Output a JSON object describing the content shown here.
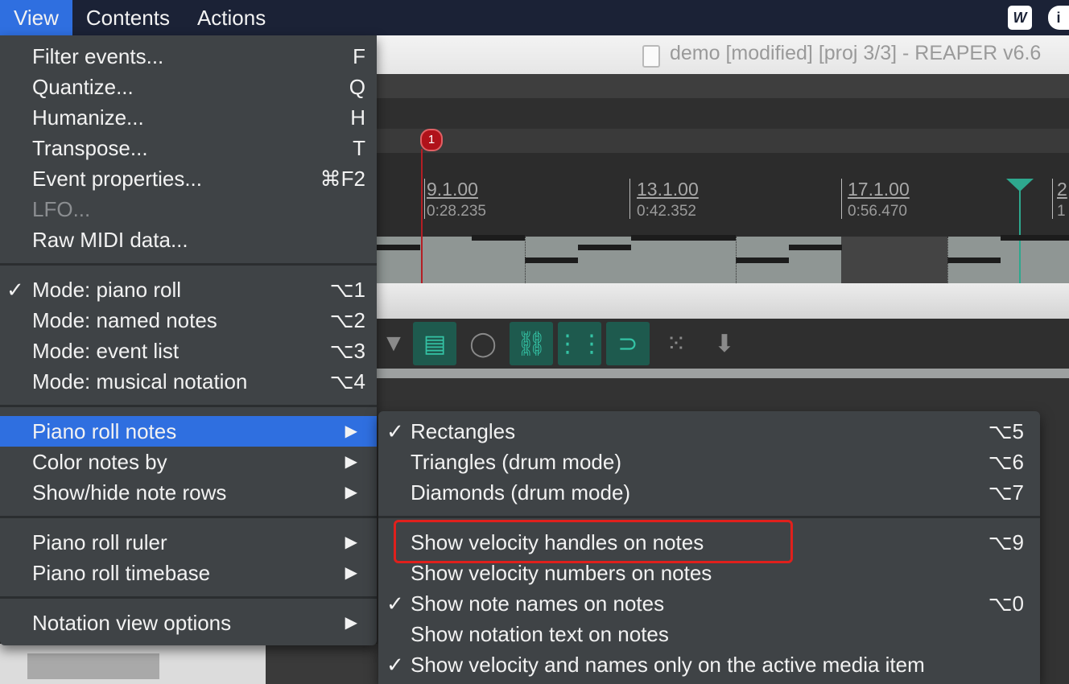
{
  "menubar": {
    "items": [
      "View",
      "Contents",
      "Actions"
    ],
    "active": "View"
  },
  "window": {
    "title": "demo [modified] [proj 3/3] - REAPER v6.6"
  },
  "ruler": {
    "marker": "1",
    "labels": [
      {
        "measure": "9.1.00",
        "time": "0:28.235"
      },
      {
        "measure": "13.1.00",
        "time": "0:42.352"
      },
      {
        "measure": "17.1.00",
        "time": "0:56.470"
      },
      {
        "measure": "2",
        "time": "1"
      }
    ]
  },
  "view_menu": {
    "items": [
      {
        "label": "Filter events...",
        "shortcut": "F"
      },
      {
        "label": "Quantize...",
        "shortcut": "Q"
      },
      {
        "label": "Humanize...",
        "shortcut": "H"
      },
      {
        "label": "Transpose...",
        "shortcut": "T"
      },
      {
        "label": "Event properties...",
        "shortcut": "⌘F2"
      },
      {
        "label": "LFO...",
        "shortcut": "",
        "disabled": true
      },
      {
        "label": "Raw MIDI data...",
        "shortcut": ""
      },
      {
        "label": "Mode: piano roll",
        "shortcut": "⌥1",
        "checked": true
      },
      {
        "label": "Mode: named notes",
        "shortcut": "⌥2"
      },
      {
        "label": "Mode: event list",
        "shortcut": "⌥3"
      },
      {
        "label": "Mode: musical notation",
        "shortcut": "⌥4"
      },
      {
        "label": "Piano roll notes",
        "submenu": true,
        "highlighted": true
      },
      {
        "label": "Color notes by",
        "submenu": true
      },
      {
        "label": "Show/hide note rows",
        "submenu": true
      },
      {
        "label": "Piano roll ruler",
        "submenu": true
      },
      {
        "label": "Piano roll timebase",
        "submenu": true
      },
      {
        "label": "Notation view options",
        "submenu": true
      }
    ],
    "check_glyph": "✓",
    "arrow_glyph": "▶"
  },
  "piano_roll_notes_submenu": {
    "items": [
      {
        "label": "Rectangles",
        "shortcut": "⌥5",
        "checked": true
      },
      {
        "label": "Triangles (drum mode)",
        "shortcut": "⌥6"
      },
      {
        "label": "Diamonds (drum mode)",
        "shortcut": "⌥7"
      },
      {
        "label": "Show velocity handles on notes",
        "shortcut": "⌥9",
        "highlighted_box": true
      },
      {
        "label": "Show velocity numbers on notes",
        "shortcut": ""
      },
      {
        "label": "Show note names on notes",
        "shortcut": "⌥0",
        "checked": true
      },
      {
        "label": "Show notation text on notes",
        "shortcut": ""
      },
      {
        "label": "Show velocity and names only on the active media item",
        "shortcut": "",
        "checked": true
      }
    ]
  },
  "colors": {
    "menubar_bg": "#1b2236",
    "menu_bg": "#3f4346",
    "selection_blue": "#2f6fe0",
    "accent_teal": "#34c3a5",
    "annotation_red": "#e0201c"
  },
  "toolbar_icons": [
    "filter-icon",
    "piano-roll-mode-icon",
    "quantize-icon",
    "link-icon",
    "grid-icon",
    "snap-icon",
    "footsteps-icon",
    "download-icon"
  ]
}
